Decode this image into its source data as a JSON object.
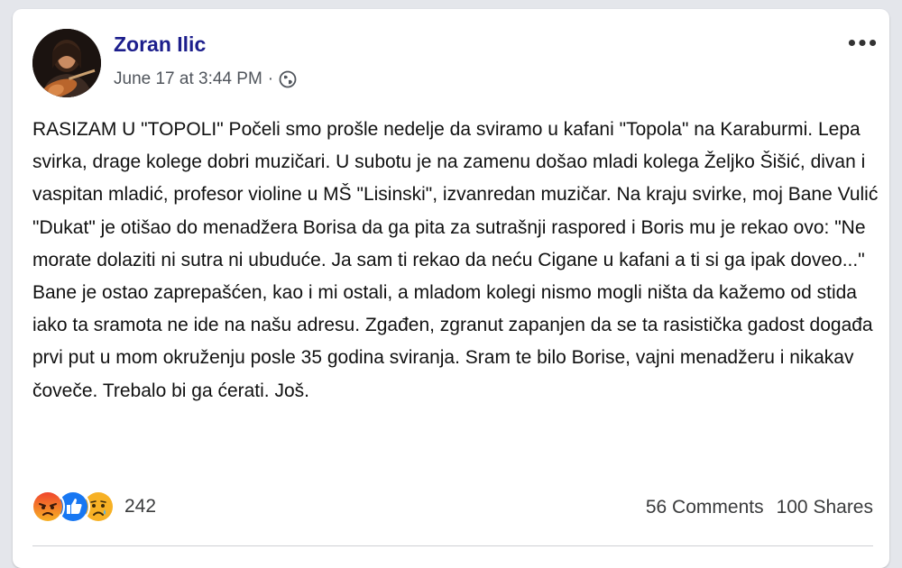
{
  "post": {
    "author": "Zoran Ilic",
    "timestamp": "June 17 at 3:44 PM",
    "separator": "·",
    "privacy_icon": "globe-icon",
    "more_icon": "more-options-icon",
    "body": "RASIZAM U \"TOPOLI\" Počeli smo prošle nedelje da sviramo u kafani \"Topola\" na Karaburmi. Lepa svirka, drage kolege dobri muzičari. U subotu je na zamenu došao mladi kolega Željko Šišić, divan i vaspitan mladić, profesor violine u MŠ \"Lisinski\", izvanredan muzičar. Na kraju svirke, moj Bane Vulić \"Dukat\" je otišao do menadžera Borisa da ga pita za sutrašnji raspored i Boris mu je rekao ovo: \"Ne morate dolaziti ni sutra ni ubuduće. Ja sam ti rekao da neću Cigane u kafani a ti si ga ipak doveo...\" Bane je ostao zaprepašćen, kao i mi ostali, a mladom kolegi nismo mogli ništa da kažemo od stida iako ta sramota ne ide na našu adresu. Zgađen, zgranut zapanjen da se ta rasistička gadost događa prvi put u mom okruženju posle 35 godina sviranja. Sram te bilo Borise, vajni menadžeru i nikakav čoveče. Trebalo bi ga ćerati. Još."
  },
  "reactions": {
    "icons": [
      "angry-reaction-icon",
      "like-reaction-icon",
      "sad-reaction-icon"
    ],
    "count": "242"
  },
  "engagement": {
    "comments": "56 Comments",
    "shares": "100 Shares"
  },
  "colors": {
    "author": "#1c1e8c",
    "like": "#1877f2",
    "angry": "#e9710f",
    "sad": "#f7b125"
  }
}
